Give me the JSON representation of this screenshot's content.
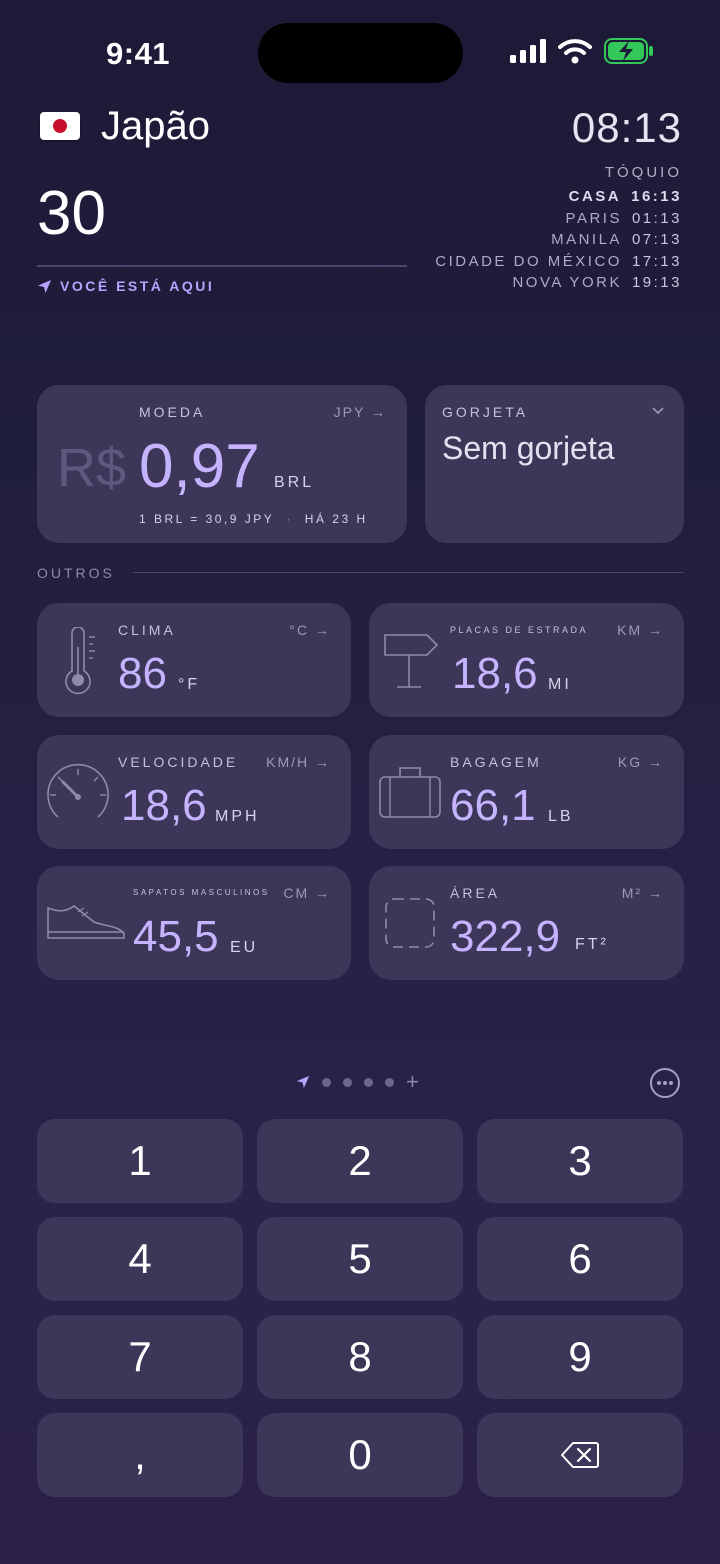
{
  "status_bar": {
    "time": "9:41",
    "battery_color": "#34c759"
  },
  "header": {
    "country": "Japão",
    "amount": "30",
    "location_label": "VOCÊ ESTÁ AQUI",
    "local_time": "08:13",
    "local_city": "TÓQUIO",
    "world_clocks": [
      {
        "city": "CASA",
        "time": "16:13"
      },
      {
        "city": "PARIS",
        "time": "01:13"
      },
      {
        "city": "MANILA",
        "time": "07:13"
      },
      {
        "city": "CIDADE DO MÉXICO",
        "time": "17:13"
      },
      {
        "city": "NOVA YORK",
        "time": "19:13"
      }
    ]
  },
  "currency": {
    "title": "MOEDA",
    "source_unit": "JPY",
    "symbol": "R$",
    "value": "0,97",
    "unit": "BRL",
    "rate": "1 BRL = 30,9 JPY",
    "updated": "HÁ 23 H"
  },
  "tip": {
    "title": "GORJETA",
    "value": "Sem gorjeta"
  },
  "section_others": "OUTROS",
  "converters": {
    "weather": {
      "title": "CLIMA",
      "src": "°C",
      "value": "86",
      "unit": "°F"
    },
    "road": {
      "title": "PLACAS DE ESTRADA",
      "src": "KM",
      "value": "18,6",
      "unit": "MI"
    },
    "speed": {
      "title": "VELOCIDADE",
      "src": "KM/H",
      "value": "18,6",
      "unit": "MPH"
    },
    "luggage": {
      "title": "BAGAGEM",
      "src": "KG",
      "value": "66,1",
      "unit": "LB"
    },
    "shoes": {
      "title": "SAPATOS MASCULINOS",
      "src": "CM",
      "value": "45,5",
      "unit": "EU"
    },
    "area": {
      "title": "ÁREA",
      "src": "M²",
      "value": "322,9",
      "unit": "FT²"
    }
  },
  "page_indicator": {
    "add": "+"
  },
  "keypad": {
    "k1": "1",
    "k2": "2",
    "k3": "3",
    "k4": "4",
    "k5": "5",
    "k6": "6",
    "k7": "7",
    "k8": "8",
    "k9": "9",
    "comma": ",",
    "k0": "0"
  },
  "colors": {
    "accent": "#c5b3ff",
    "card": "#3c3658",
    "background": "#1c1a36"
  }
}
